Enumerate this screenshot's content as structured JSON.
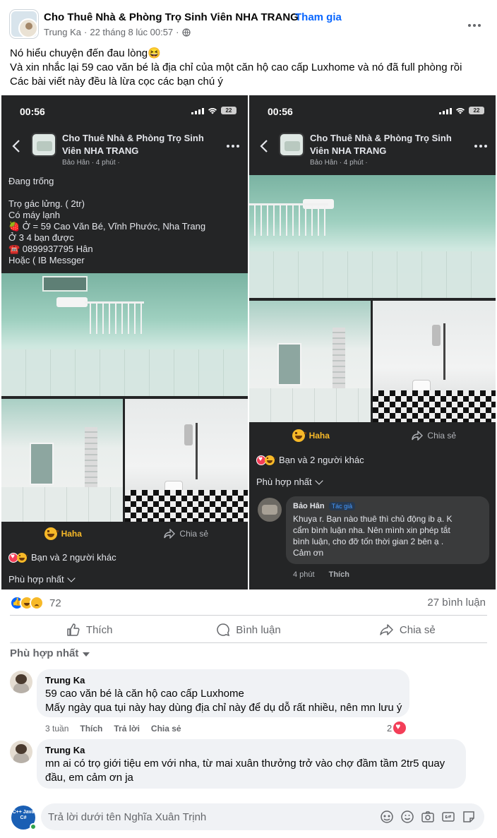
{
  "post": {
    "group_name": "Cho Thuê Nhà & Phòng Trọ Sinh Viên NHA TRANG",
    "dot": "·",
    "join_label": "Tham gia",
    "author": "Trung Ka",
    "timestamp": "22 tháng 8 lúc 00:57",
    "text_lines": [
      "Nó hiểu chuyện đến đau lòng😆",
      "Và xin nhắc lại 59 cao văn bé là địa chỉ của một căn hộ cao cấp Luxhome và nó đã full phòng rồi",
      "Các bài viết này đều là lừa cọc các bạn chú ý"
    ]
  },
  "screenshot_left": {
    "time": "00:56",
    "battery": "22",
    "group_name": "Cho Thuê Nhà & Phòng Trọ Sinh Viên NHA TRANG",
    "meta": "Bảo Hân · 4 phút ·",
    "listing": [
      "Đang trống",
      "",
      "Trọ gác lửng. ( 2tr)",
      "Có máy lạnh",
      "🍓 Ở = 59 Cao Văn Bé, Vĩnh Phước, Nha Trang",
      "Ở 3 4 bạn được",
      "☎️ 0899937795 Hân",
      "Hoặc ( IB Messger"
    ],
    "haha_label": "Haha",
    "share_label": "Chia sẻ",
    "reactions_text": "Bạn và 2 người khác",
    "relevant_label": "Phù hợp nhất"
  },
  "screenshot_right": {
    "time": "00:56",
    "battery": "22",
    "group_name": "Cho Thuê Nhà & Phòng Trọ Sinh Viên NHA TRANG",
    "meta": "Bảo Hân · 4 phút ·",
    "haha_label": "Haha",
    "share_label": "Chia sẻ",
    "reactions_text": "Bạn và 2 người khác",
    "relevant_label": "Phù hợp nhất",
    "comment": {
      "author": "Bảo Hân",
      "badge": "Tác giả",
      "lines": [
        "Khuya r. Bạn nào thuê thì chủ động ib ạ. K",
        "cẩm bình luận nha. Nên mình xin phép tắt",
        "bình luận, cho đỡ tốn thời gian 2 bên ạ .",
        "Cảm ơn"
      ],
      "time": "4 phút",
      "like": "Thích"
    }
  },
  "reactions": {
    "count": "72",
    "comments": "27 bình luận"
  },
  "actions": {
    "like": "Thích",
    "comment": "Bình luận",
    "share": "Chia sẻ"
  },
  "sort_label": "Phù hợp nhất",
  "comments": [
    {
      "author": "Trung Ka",
      "lines": [
        "59 cao văn bé là căn hộ cao cấp Luxhome",
        "Mấy ngày qua tụi này hay dùng địa chỉ này để dụ dỗ rất nhiều, nên mn lưu ý"
      ],
      "time": "3 tuần",
      "like": "Thích",
      "reply": "Trả lời",
      "share": "Chia sẻ",
      "reaction_count": "2"
    },
    {
      "author": "Trung Ka",
      "lines": [
        "mn ai có trọ giới tiệu em với nha, từ mai xuân thưởng trở vào chợ đầm tầm 2tr5 quay",
        "đầu, em cảm ơn ja"
      ]
    }
  ],
  "composer": {
    "placeholder": "Trả lời dưới tên Nghĩa Xuân Trịnh",
    "avatar_text": "C++ Java C#"
  },
  "colors": {
    "accent": "#0866ff",
    "dark_bg": "#242526",
    "heart": "#f33e58",
    "haha": "#f7b928"
  },
  "icons": [
    "globe-icon",
    "more-icon",
    "close-icon",
    "back-icon",
    "haha-icon",
    "share-icon",
    "like-icon",
    "comment-icon",
    "heart-icon",
    "emoji-icon",
    "camera-icon",
    "gif-icon",
    "sticker-icon",
    "avatar-sticker-icon"
  ]
}
